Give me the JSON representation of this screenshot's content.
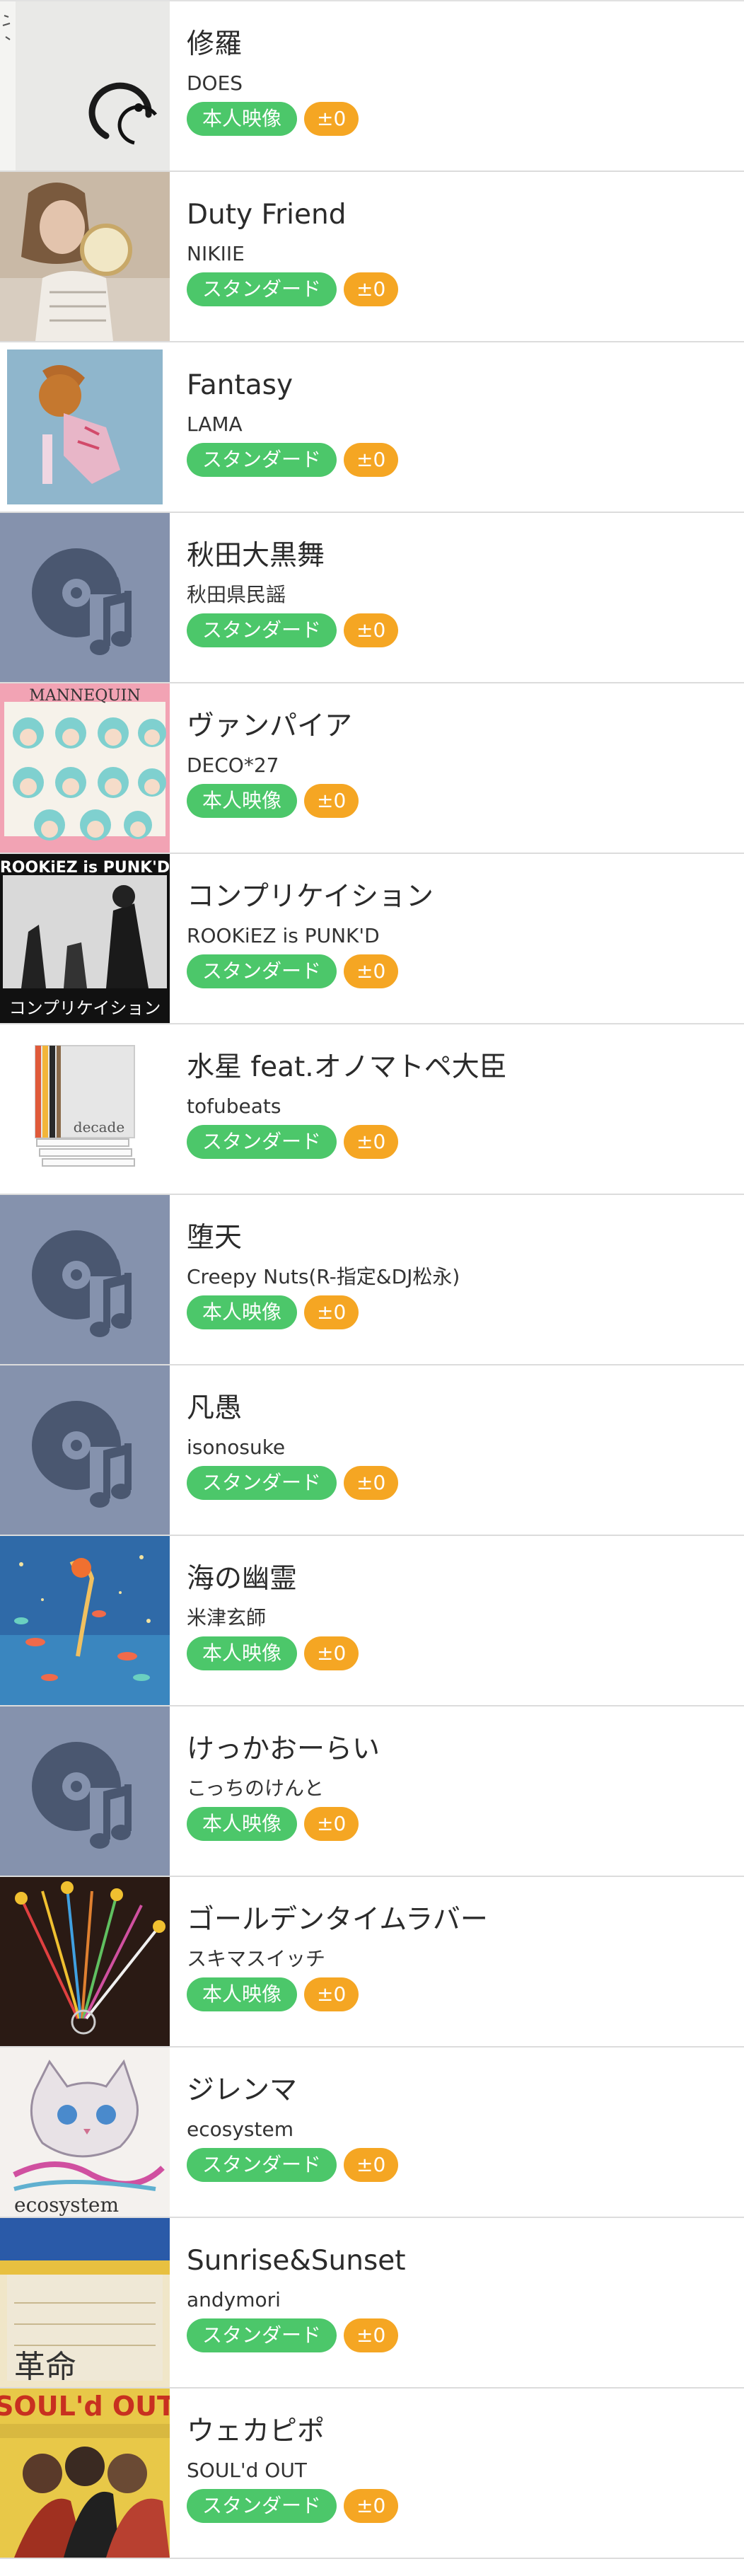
{
  "songs": [
    {
      "title": "修羅",
      "artist": "DOES",
      "type": "本人映像",
      "diff": "±0",
      "art": "ink-circle-jacket"
    },
    {
      "title": "Duty Friend",
      "artist": "NIKIIE",
      "type": "スタンダード",
      "diff": "±0",
      "art": "photo-girl-jacket"
    },
    {
      "title": "Fantasy",
      "artist": "LAMA",
      "type": "スタンダード",
      "diff": "±0",
      "art": "doll-guitar-jacket"
    },
    {
      "title": "秋田大黒舞",
      "artist": "秋田県民謡",
      "type": "スタンダード",
      "diff": "±0",
      "art": "no-image-disc-icon"
    },
    {
      "title": "ヴァンパイア",
      "artist": "DECO*27",
      "type": "本人映像",
      "diff": "±0",
      "art": "mannequin-jacket"
    },
    {
      "title": "コンプリケイション",
      "artist": "ROOKiEZ is PUNK'D",
      "type": "スタンダード",
      "diff": "±0",
      "art": "band-photo-jacket"
    },
    {
      "title": "水星 feat.オノマトペ大臣",
      "artist": "tofubeats",
      "type": "スタンダード",
      "diff": "±0",
      "art": "decade-jacket"
    },
    {
      "title": "堕天",
      "artist": "Creepy Nuts(R-指定&DJ松永)",
      "type": "本人映像",
      "diff": "±0",
      "art": "no-image-disc-icon"
    },
    {
      "title": "凡愚",
      "artist": "isonosuke",
      "type": "スタンダード",
      "diff": "±0",
      "art": "no-image-disc-icon"
    },
    {
      "title": "海の幽霊",
      "artist": "米津玄師",
      "type": "本人映像",
      "diff": "±0",
      "art": "ocean-illustration-jacket"
    },
    {
      "title": "けっかおーらい",
      "artist": "こっちのけんと",
      "type": "本人映像",
      "diff": "±0",
      "art": "no-image-disc-icon"
    },
    {
      "title": "ゴールデンタイムラバー",
      "artist": "スキマスイッチ",
      "type": "本人映像",
      "diff": "±0",
      "art": "colorful-sticks-jacket"
    },
    {
      "title": "ジレンマ",
      "artist": "ecosystem",
      "type": "スタンダード",
      "diff": "±0",
      "art": "cat-creature-jacket"
    },
    {
      "title": "Sunrise&Sunset",
      "artist": "andymori",
      "type": "スタンダード",
      "diff": "±0",
      "art": "kakumei-jacket"
    },
    {
      "title": "ウェカピポ",
      "artist": "SOUL'd OUT",
      "type": "スタンダード",
      "diff": "±0",
      "art": "group-photo-jacket"
    }
  ],
  "jacket_text": {
    "kakumei": "革命",
    "decade": "decade",
    "mannequin": "MANNEQUIN",
    "rookiez": "ROOKiEZ is PUNK'D",
    "rookiez_sub": "コンプリケイション",
    "soul": "SOUL'd OUT",
    "eco": "ecosystem"
  },
  "colors": {
    "type_badge": "#4cc76a",
    "diff_badge": "#f5a623",
    "placeholder_bg": "#8592ad",
    "placeholder_icon": "#4a5770"
  }
}
